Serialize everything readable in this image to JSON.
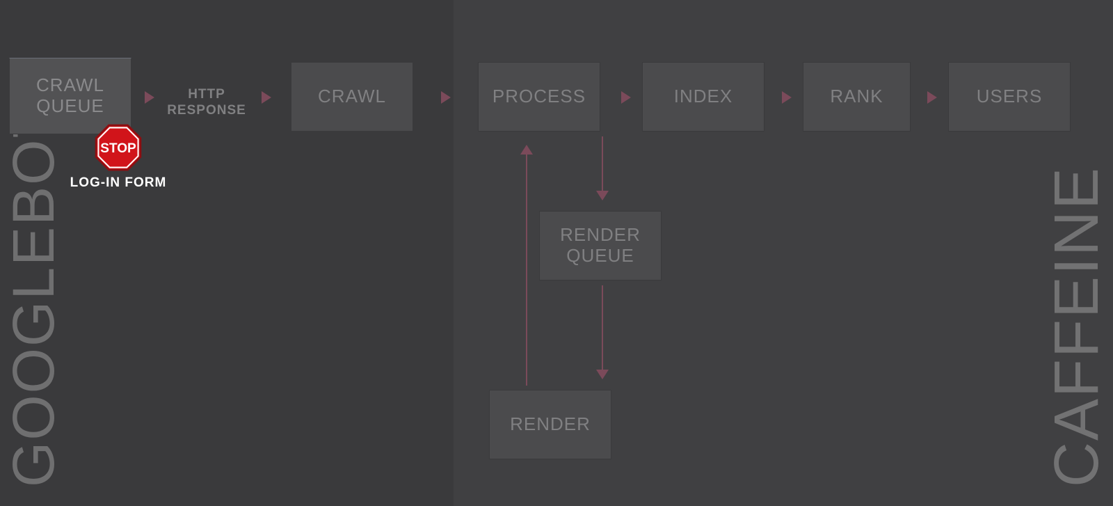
{
  "side_labels": {
    "left": "GOOGLEBOT",
    "right": "CAFFEINE"
  },
  "nodes": {
    "crawl_queue": "CRAWL QUEUE",
    "crawl": "CRAWL",
    "process": "PROCESS",
    "index": "INDEX",
    "rank": "RANK",
    "users": "USERS",
    "render_queue": "RENDER QUEUE",
    "render": "RENDER"
  },
  "connector": {
    "http_response": "HTTP RESPONSE"
  },
  "stop": {
    "sign_text": "STOP",
    "caption": "LOG-IN FORM"
  },
  "colors": {
    "bg": "#3a3a3c",
    "node": "#4b4b4d",
    "node_highlight": "#525254",
    "text_dim": "#808082",
    "arrow": "#7b4a5a",
    "stop_red": "#d1141a",
    "stop_text": "#ffffff"
  }
}
